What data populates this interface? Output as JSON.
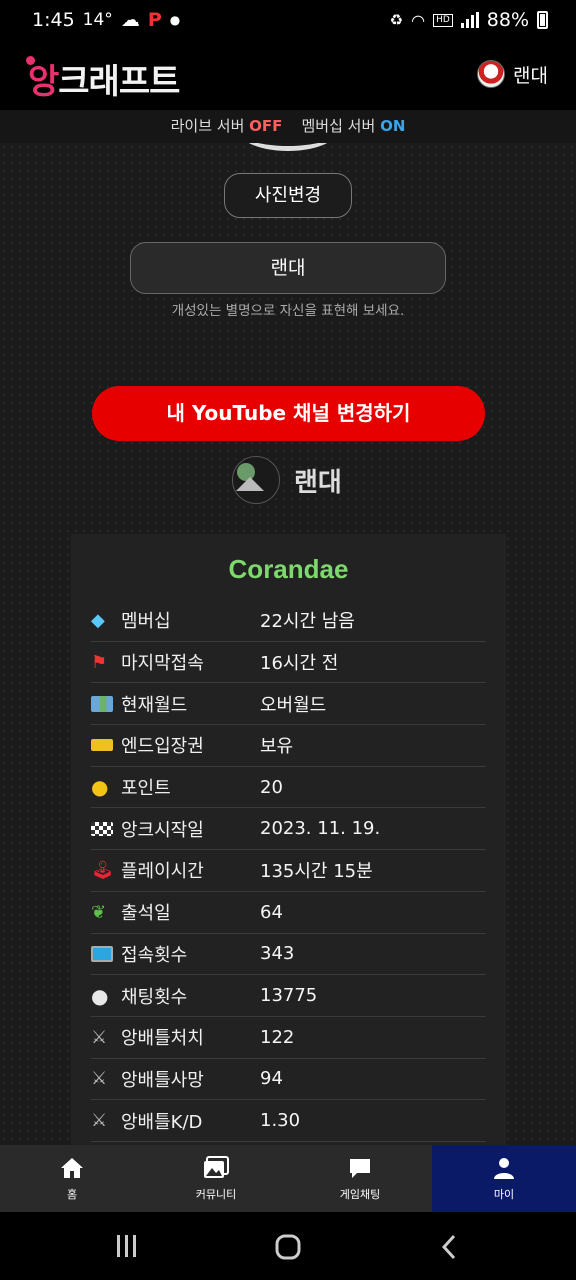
{
  "status": {
    "time": "1:45",
    "temp": "14°",
    "battery": "88%"
  },
  "header": {
    "logo_main": "앙",
    "logo_rest": "크래프트",
    "username": "랜대"
  },
  "server": {
    "live_label": "라이브 서버",
    "live_state": "OFF",
    "member_label": "멤버십 서버",
    "member_state": "ON"
  },
  "profile": {
    "change_photo": "사진변경",
    "nickname": "랜대",
    "nickname_help": "개성있는 별명으로 자신을 표현해 보세요.",
    "youtube_button": "내 YouTube 채널 변경하기",
    "channel_name": "랜대"
  },
  "stats": {
    "title": "Corandae",
    "rows": [
      {
        "icon": "gem-icon",
        "label": "멤버십",
        "value": "22시간 남음"
      },
      {
        "icon": "flag-icon",
        "label": "마지막접속",
        "value": "16시간 전"
      },
      {
        "icon": "map-icon",
        "label": "현재월드",
        "value": "오버월드"
      },
      {
        "icon": "ticket-icon",
        "label": "엔드입장권",
        "value": "보유"
      },
      {
        "icon": "coin-icon",
        "label": "포인트",
        "value": "20"
      },
      {
        "icon": "checkered-flag-icon",
        "label": "앙크시작일",
        "value": "2023. 11. 19."
      },
      {
        "icon": "joystick-icon",
        "label": "플레이시간",
        "value": "135시간 15분"
      },
      {
        "icon": "seedling-icon",
        "label": "출석일",
        "value": "64"
      },
      {
        "icon": "monitor-icon",
        "label": "접속횟수",
        "value": "343"
      },
      {
        "icon": "speech-bubble-icon",
        "label": "채팅횟수",
        "value": "13775"
      },
      {
        "icon": "crossed-swords-icon",
        "label": "앙배틀처치",
        "value": "122"
      },
      {
        "icon": "crossed-swords-icon",
        "label": "앙배틀사망",
        "value": "94"
      },
      {
        "icon": "crossed-swords-icon",
        "label": "앙배틀K/D",
        "value": "1.30"
      }
    ]
  },
  "nav": {
    "home": "홈",
    "community": "커뮤니티",
    "chat": "게임채팅",
    "my": "마이"
  }
}
